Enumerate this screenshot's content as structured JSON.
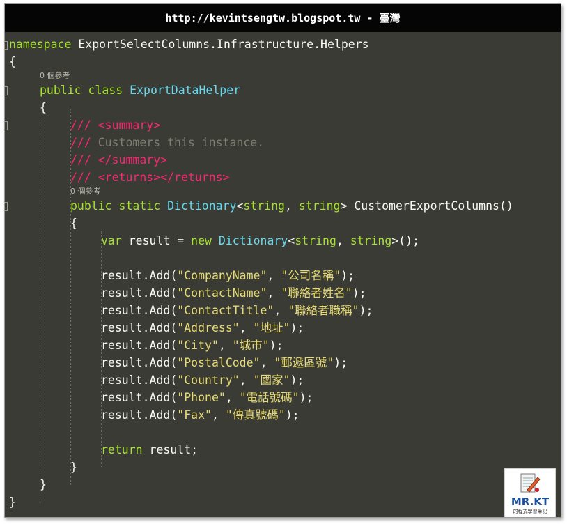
{
  "window": {
    "title": "http://kevintsengtw.blogspot.tw - 臺灣"
  },
  "editor": {
    "refs_hint": "0 個參考",
    "lines": {
      "namespace_kw": "namespace",
      "namespace_name": "ExportSelectColumns.Infrastructure.Helpers",
      "open_ns": "{",
      "public_kw": "public",
      "class_kw": "class",
      "class_name": "ExportDataHelper",
      "open_class": "{",
      "doc_prefix": "///",
      "summary_open": "<summary>",
      "summary_text": "Customers this instance.",
      "summary_close": "</summary>",
      "returns_tag": "<returns></returns>",
      "static_kw": "static",
      "dictionary_type": "Dictionary",
      "string_kw": "string",
      "method_name": "CustomerExportColumns()",
      "open_method": "{",
      "var_kw": "var",
      "result_assign": "result =",
      "new_kw": "new",
      "ctor_tail": "();",
      "add_prefix": "result.Add(",
      "add_suffix": ");",
      "return_kw": "return",
      "return_tail": "result;",
      "close_method": "}",
      "close_class": "}",
      "close_ns": "}"
    },
    "columns": [
      {
        "key": "\"CompanyName\"",
        "value": "\"公司名稱\""
      },
      {
        "key": "\"ContactName\"",
        "value": "\"聯絡者姓名\""
      },
      {
        "key": "\"ContactTitle\"",
        "value": "\"聯絡者職稱\""
      },
      {
        "key": "\"Address\"",
        "value": "\"地址\""
      },
      {
        "key": "\"City\"",
        "value": "\"城市\""
      },
      {
        "key": "\"PostalCode\"",
        "value": "\"郵遞區號\""
      },
      {
        "key": "\"Country\"",
        "value": "\"國家\""
      },
      {
        "key": "\"Phone\"",
        "value": "\"電話號碼\""
      },
      {
        "key": "\"Fax\"",
        "value": "\"傳真號碼\""
      }
    ]
  },
  "logo": {
    "brand": "MR.KT",
    "subtitle": "的程式學習筆記"
  },
  "colors": {
    "background": "#3b3b35",
    "keyword": "#a6e22e",
    "type": "#66d9ef",
    "doc_comment": "#f92672",
    "string": "#e6db74"
  }
}
